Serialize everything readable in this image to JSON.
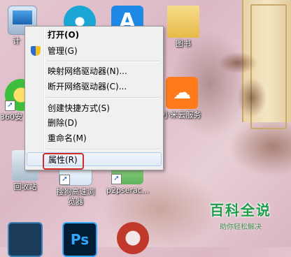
{
  "desktop": {
    "icons": {
      "computer": "计",
      "player": "",
      "appstore": "",
      "folder": "图书",
      "app360": "360安",
      "cloud": "小米云服务",
      "recycle": "回收站",
      "sogou": "搜狗高速浏览器",
      "p2p": "p2pserac...",
      "ps": "Ps"
    }
  },
  "context_menu": {
    "items": [
      {
        "label": "打开(O)"
      },
      {
        "label": "管理(G)"
      },
      {
        "label": "映射网络驱动器(N)..."
      },
      {
        "label": "断开网络驱动器(C)..."
      },
      {
        "label": "创建快捷方式(S)"
      },
      {
        "label": "删除(D)"
      },
      {
        "label": "重命名(M)"
      },
      {
        "label": "属性(R)"
      }
    ]
  },
  "watermark": {
    "title": "百科全说",
    "subtitle": "助你轻松解决"
  },
  "colors": {
    "highlight_box": "#d12b2b",
    "watermark_green": "#1c9e4b"
  }
}
